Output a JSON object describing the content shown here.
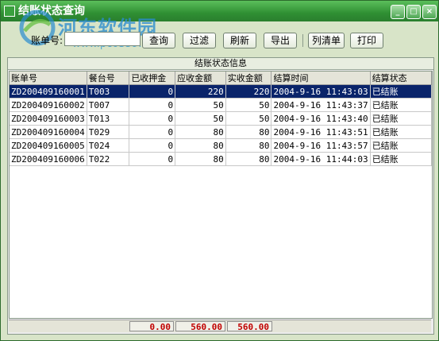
{
  "window": {
    "title": "结账状态查询",
    "minimize": "_",
    "maximize": "□",
    "close": "×"
  },
  "watermark": {
    "brand": "河东软件园",
    "url": "www.pc0359.cn"
  },
  "toolbar": {
    "account_label": "账单号:",
    "account_value": "",
    "buttons": [
      "查询",
      "过滤",
      "刷新",
      "导出",
      "列清单",
      "打印"
    ]
  },
  "panel": {
    "title": "结账状态信息"
  },
  "table": {
    "columns": [
      "账单号",
      "餐台号",
      "已收押金",
      "应收金额",
      "实收金额",
      "结算时间",
      "结算状态"
    ],
    "rows": [
      [
        "ZD200409160001",
        "T003",
        "0",
        "220",
        "220",
        "2004-9-16 11:43:03",
        "已结账"
      ],
      [
        "ZD200409160002",
        "T007",
        "0",
        "50",
        "50",
        "2004-9-16 11:43:37",
        "已结账"
      ],
      [
        "ZD200409160003",
        "T013",
        "0",
        "50",
        "50",
        "2004-9-16 11:43:40",
        "已结账"
      ],
      [
        "ZD200409160004",
        "T029",
        "0",
        "80",
        "80",
        "2004-9-16 11:43:51",
        "已结账"
      ],
      [
        "ZD200409160005",
        "T024",
        "0",
        "80",
        "80",
        "2004-9-16 11:43:57",
        "已结账"
      ],
      [
        "ZD200409160006",
        "T022",
        "0",
        "80",
        "80",
        "2004-9-16 11:44:03",
        "已结账"
      ]
    ],
    "selected_row": 0
  },
  "totals": {
    "deposit": "0.00",
    "receivable": "560.00",
    "received": "560.00"
  }
}
